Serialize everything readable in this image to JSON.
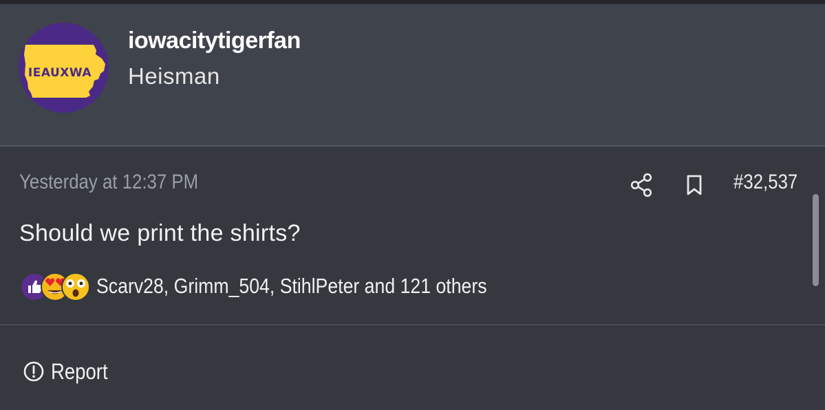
{
  "user": {
    "avatar_text": "IEAUXWA",
    "username": "iowacitytigerfan",
    "title": "Heisman"
  },
  "post": {
    "timestamp": "Yesterday at 12:37 PM",
    "number": "#32,537",
    "body": "Should we print the shirts?",
    "actions": {
      "share_icon": "share-icon",
      "bookmark_icon": "bookmark-icon"
    }
  },
  "reactions": {
    "icons": [
      "like-icon",
      "heart-eyes-icon",
      "astonished-icon"
    ],
    "summary": "Scarv28, Grimm_504, StihlPeter and 121 others"
  },
  "footer": {
    "report_label": "Report",
    "report_icon": "alert-circle-icon"
  },
  "colors": {
    "avatar_purple": "#4a2a86",
    "avatar_gold": "#fdd23a",
    "like_purple": "#5b2d8e"
  }
}
